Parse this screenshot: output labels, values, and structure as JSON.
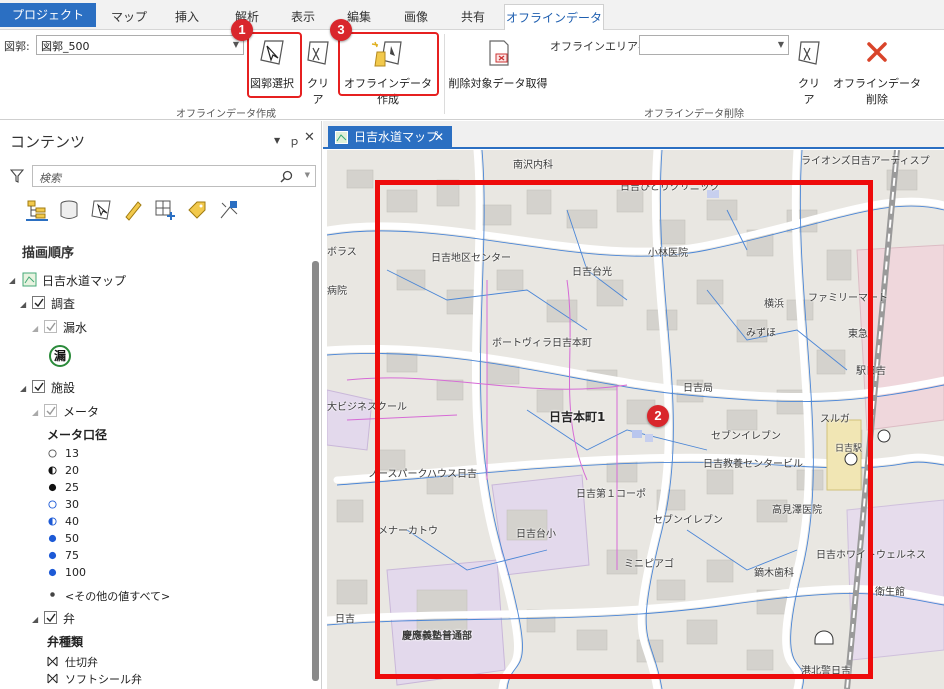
{
  "ribbon": {
    "tabs": [
      "プロジェクト",
      "マップ",
      "挿入",
      "解析",
      "表示",
      "編集",
      "画像",
      "共有",
      "オフラインデータ"
    ],
    "active_tab": "オフラインデータ",
    "zukaku_label": "図郭:",
    "zukaku_value": "図郭_500",
    "buttons": {
      "zukaku_select": "図郭選択",
      "clear1": "クリア",
      "offline_create": "オフラインデータ作成",
      "delete_target": "削除対象データ取得",
      "clear2": "クリア",
      "offline_delete": "オフラインデータ削除"
    },
    "offline_area_label": "オフラインエリア名:",
    "offline_area_value": "",
    "group_create": "オフラインデータ作成",
    "group_delete": "オフラインデータ削除"
  },
  "annotations": {
    "badge1": "1",
    "badge2": "2",
    "badge3": "3"
  },
  "contents": {
    "title": "コンテンツ",
    "search_placeholder": "検索",
    "draw_order": "描画順序",
    "map_name": "日吉水道マップ",
    "layer_chousa": "調査",
    "layer_rousui": "漏水",
    "rousui_symbol": "漏",
    "layer_shisetsu": "施設",
    "layer_meter": "メータ",
    "meter_field": "メータ口径",
    "meter_values": [
      "13",
      "20",
      "25",
      "30",
      "40",
      "50",
      "75",
      "100"
    ],
    "other_values": "<その他の値すべて>",
    "layer_ben": "弁",
    "ben_field": "弁種類",
    "ben_values": [
      "仕切弁",
      "ソフトシール弁"
    ]
  },
  "map_tab": {
    "title": "日吉水道マップ"
  },
  "map_labels": [
    "南沢内科",
    "ライオンズ日吉アーティスプ",
    "日吉ひとりクリニック",
    "小林医院",
    "日吉地区センター",
    "日吉台光",
    "横浜",
    "ファミリーマート",
    "みずほ",
    "東急",
    "ボートヴィラ日吉本町",
    "日吉局",
    "駅日吉",
    "大ビジネスクール",
    "日吉本町1",
    "スルガ",
    "セブンイレブン",
    "日吉駅",
    "日吉教養センタービル",
    "ノースパークハウス日吉",
    "日吉第１コーポ",
    "高見澤医院",
    "メナーカトウ",
    "日吉台小",
    "セブンイレブン",
    "日吉ホワイトウェルネス",
    "ミニピアゴ",
    "鏑木歯科",
    "衛生館",
    "慶應義塾普通部",
    "港北警日吉",
    "ボラス",
    "病院",
    "日吉"
  ]
}
